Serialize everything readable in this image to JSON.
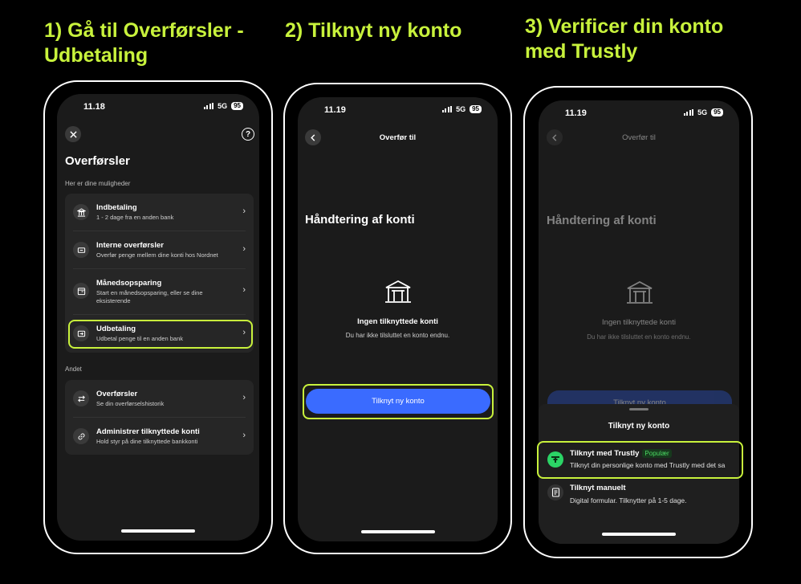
{
  "steps": [
    {
      "title_line1": "1) Gå til Overførsler -",
      "title_line2": "Udbetaling"
    },
    {
      "title_line1": "2) Tilknyt ny konto",
      "title_line2": ""
    },
    {
      "title_line1": "3) Verificer din konto",
      "title_line2": "med Trustly"
    }
  ],
  "accent_color": "#c8f23c",
  "phone1": {
    "status": {
      "time": "11.18",
      "network": "5G",
      "battery": "95"
    },
    "help": "?",
    "page_title": "Overførsler",
    "section1_label": "Her er dine muligheder",
    "section1_items": [
      {
        "icon": "bank-icon",
        "title": "Indbetaling",
        "sub": "1 - 2 dage fra en anden bank"
      },
      {
        "icon": "transfer-icon",
        "title": "Interne overførsler",
        "sub": "Overfør penge mellem dine konti hos Nordnet"
      },
      {
        "icon": "calendar-icon",
        "title": "Månedsopsparing",
        "sub": "Start en månedsopsparing, eller se dine",
        "sub2": "eksisterende"
      },
      {
        "icon": "payout-icon",
        "title": "Udbetaling",
        "sub": "Udbetal penge til en anden bank"
      }
    ],
    "section2_label": "Andet",
    "section2_items": [
      {
        "icon": "arrows-icon",
        "title": "Overførsler",
        "sub": "Se din overførselshistorik"
      },
      {
        "icon": "link-icon",
        "title": "Administrer tilknyttede konti",
        "sub": "Hold styr på dine tilknyttede bankkonti"
      }
    ]
  },
  "phone2": {
    "status": {
      "time": "11.19",
      "network": "5G",
      "battery": "95"
    },
    "nav_title": "Overfør til",
    "heading": "Håndtering af konti",
    "empty_title": "Ingen tilknyttede konti",
    "empty_sub": "Du har ikke tilsluttet en konto endnu.",
    "button": "Tilknyt ny konto"
  },
  "phone3": {
    "status": {
      "time": "11.19",
      "network": "5G",
      "battery": "95"
    },
    "nav_title": "Overfør til",
    "heading": "Håndtering af konti",
    "empty_title": "Ingen tilknyttede konti",
    "empty_sub": "Du har ikke tilsluttet en konto endnu.",
    "button_partial": "Tilknyt ny konto",
    "sheet_title": "Tilknyt ny konto",
    "options": [
      {
        "title": "Tilknyt med Trustly",
        "badge": "Populær",
        "sub": "Tilknyt din personlige konto med Trustly med det sa"
      },
      {
        "title": "Tilknyt manuelt",
        "sub": "Digital formular. Tilknytter på 1-5 dage."
      }
    ]
  }
}
